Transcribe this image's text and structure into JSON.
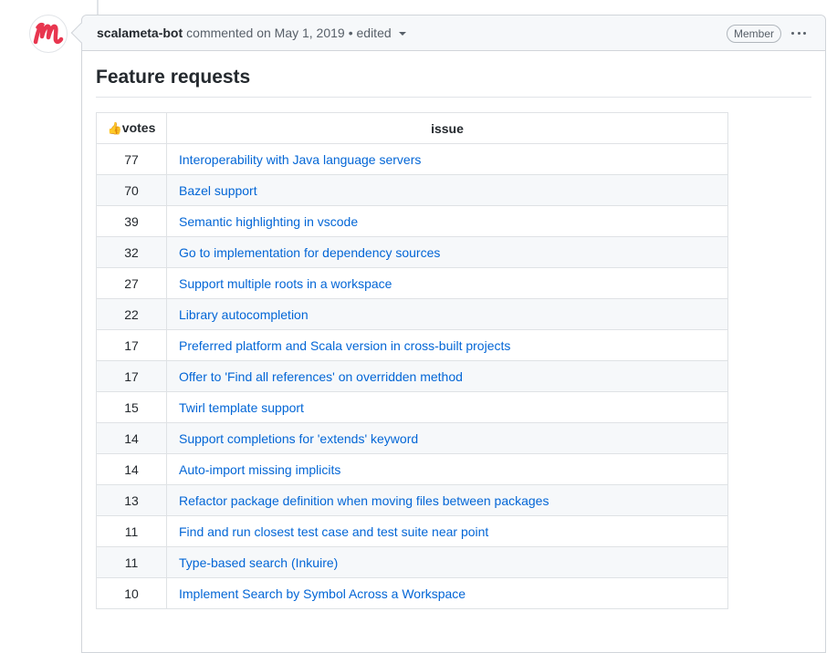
{
  "comment": {
    "author": "scalameta-bot",
    "meta_text": "commented on May 1, 2019",
    "edited_label": "• edited",
    "badge": "Member",
    "menu_icon": "kebab-horizontal-icon"
  },
  "body": {
    "heading": "Feature requests",
    "table": {
      "headers": {
        "votes_icon": "👍",
        "votes": "votes",
        "issue": "issue"
      },
      "rows": [
        {
          "votes": "77",
          "issue": "Interoperability with Java language servers"
        },
        {
          "votes": "70",
          "issue": "Bazel support"
        },
        {
          "votes": "39",
          "issue": "Semantic highlighting in vscode"
        },
        {
          "votes": "32",
          "issue": "Go to implementation for dependency sources"
        },
        {
          "votes": "27",
          "issue": "Support multiple roots in a workspace"
        },
        {
          "votes": "22",
          "issue": "Library autocompletion"
        },
        {
          "votes": "17",
          "issue": "Preferred platform and Scala version in cross-built projects"
        },
        {
          "votes": "17",
          "issue": "Offer to 'Find all references' on overridden method"
        },
        {
          "votes": "15",
          "issue": "Twirl template support"
        },
        {
          "votes": "14",
          "issue": "Support completions for 'extends' keyword"
        },
        {
          "votes": "14",
          "issue": "Auto-import missing implicits"
        },
        {
          "votes": "13",
          "issue": "Refactor package definition when moving files between packages"
        },
        {
          "votes": "11",
          "issue": "Find and run closest test case and test suite near point"
        },
        {
          "votes": "11",
          "issue": "Type-based search (Inkuire)"
        },
        {
          "votes": "10",
          "issue": "Implement Search by Symbol Across a Workspace"
        }
      ]
    }
  },
  "colors": {
    "link": "#0366d6",
    "avatar_brand": "#e8364f"
  }
}
